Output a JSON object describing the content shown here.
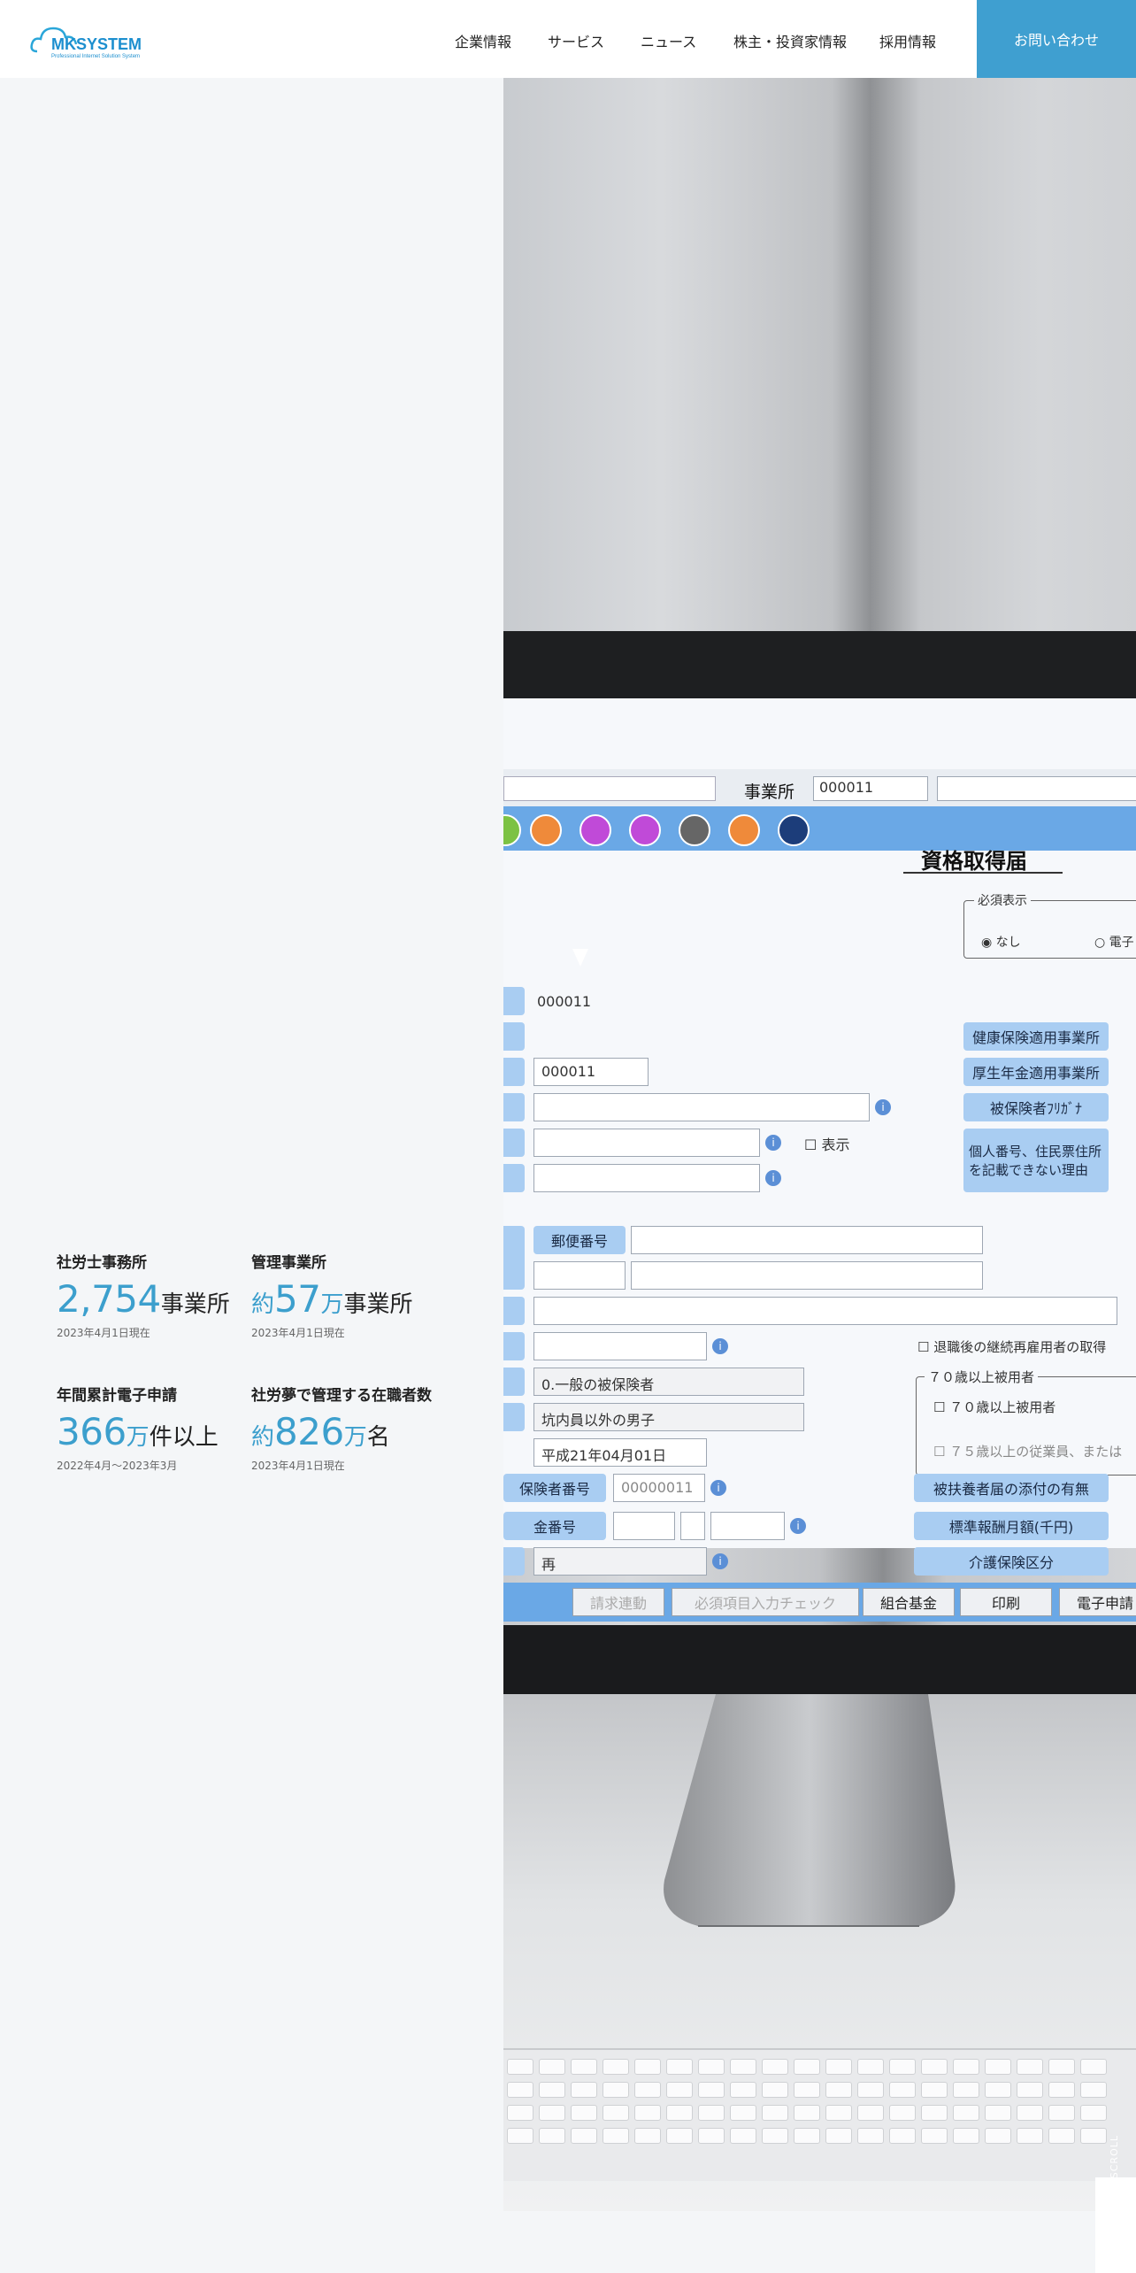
{
  "header": {
    "logo_text": "MKSYSTEM",
    "logo_tagline": "Professional Internet Solution System",
    "nav": [
      {
        "label": "企業情報"
      },
      {
        "label": "サービス"
      },
      {
        "label": "ニュース"
      },
      {
        "label": "株主・投資家情報"
      },
      {
        "label": "採用情報"
      }
    ],
    "contact_label": "お問い合わせ",
    "accent_color": "#3f9fd0"
  },
  "stats": [
    {
      "label": "社労士事務所",
      "prefix": "",
      "number": "2,754",
      "unit_blue": "",
      "unit": "事業所",
      "note": "2023年4月1日現在"
    },
    {
      "label": "管理事業所",
      "prefix": "約",
      "number": "57",
      "unit_blue": "万",
      "unit": "事業所",
      "note": "2023年4月1日現在"
    },
    {
      "label": "年間累計電子申請",
      "prefix": "",
      "number": "366",
      "unit_blue": "万",
      "unit": "件以上",
      "note": "2022年4月〜2023年3月"
    },
    {
      "label": "社労夢で管理する在職者数",
      "prefix": "約",
      "number": "826",
      "unit_blue": "万",
      "unit": "名",
      "note": "2023年4月1日現在"
    }
  ],
  "screen": {
    "office_label": "事業所",
    "office_code": "000011",
    "form_title": "資格取得届",
    "required_display": "必須表示",
    "radio_none": "なし",
    "radio_elec": "電子",
    "field_code1": "000011",
    "field_code2": "000011",
    "show_label": "表示",
    "postal_label": "郵便番号",
    "right_pills": [
      "健康保険適用事業所",
      "厚生年金適用事業所",
      "被保険者ﾌﾘｶﾞﾅ"
    ],
    "reason_text_1": "個人番号、住民票住所",
    "reason_text_2": "を記載できない理由",
    "retire_check": "退職後の継続再雇用者の取得",
    "over70_group": "７０歳以上被用者",
    "over70_check": "７０歳以上被用者",
    "over75_check": "７５歳以上の従業員、または",
    "insured_type": "0.一般の被保険者",
    "gender_type": "坑内員以外の男子",
    "date_value": "平成21年04月01日",
    "insured_no_label": "保険者番号",
    "insured_no_value": "00000011",
    "pension_no_label": "金番号",
    "select_value": "再",
    "dependent_pill": "被扶養者届の添付の有無",
    "salary_pill": "標準報酬月額(千円)",
    "care_pill": "介護保険区分",
    "buttons": [
      "請求連動",
      "必須項目入力チェック",
      "組合基金",
      "印刷",
      "電子申請"
    ]
  },
  "scroll_label": "SCROLL"
}
